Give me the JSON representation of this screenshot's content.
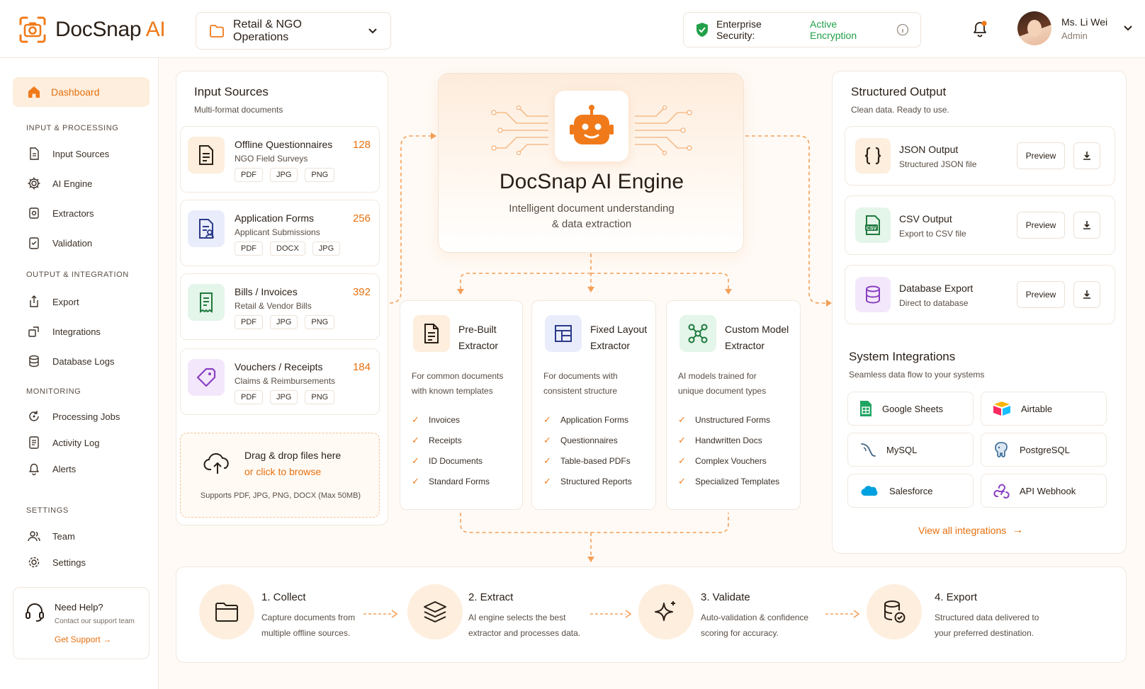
{
  "header": {
    "logo_main": "DocSnap",
    "logo_accent": "AI",
    "workspace": "Retail & NGO Operations",
    "security_label": "Enterprise Security:",
    "security_value": "Active Encryption",
    "user_name": "Ms. Li Wei",
    "user_role": "Admin"
  },
  "sidebar": {
    "active": "Dashboard",
    "sections": [
      {
        "title": "INPUT & PROCESSING",
        "items": [
          "Input Sources",
          "AI Engine",
          "Extractors",
          "Validation"
        ]
      },
      {
        "title": "OUTPUT & INTEGRATION",
        "items": [
          "Export",
          "Integrations",
          "Database Logs"
        ]
      },
      {
        "title": "MONITORING",
        "items": [
          "Processing Jobs",
          "Activity Log",
          "Alerts"
        ]
      },
      {
        "title": "SETTINGS",
        "items": [
          "Team",
          "Settings"
        ]
      }
    ],
    "help": {
      "title": "Need Help?",
      "subtitle": "Contact our support team",
      "link": "Get Support"
    }
  },
  "input_sources": {
    "title": "Input Sources",
    "subtitle": "Multi-format documents",
    "items": [
      {
        "title": "Offline Questionnaires",
        "subtitle": "NGO Field Surveys",
        "count": "128",
        "tags": [
          "PDF",
          "JPG",
          "PNG"
        ]
      },
      {
        "title": "Application Forms",
        "subtitle": "Applicant Submissions",
        "count": "256",
        "tags": [
          "PDF",
          "DOCX",
          "JPG"
        ]
      },
      {
        "title": "Bills / Invoices",
        "subtitle": "Retail & Vendor Bills",
        "count": "392",
        "tags": [
          "PDF",
          "JPG",
          "PNG"
        ]
      },
      {
        "title": "Vouchers / Receipts",
        "subtitle": "Claims & Reimbursements",
        "count": "184",
        "tags": [
          "PDF",
          "JPG",
          "PNG"
        ]
      }
    ],
    "drop": {
      "title": "Drag & drop files here",
      "link": "or click to browse",
      "note": "Supports PDF, JPG, PNG, DOCX (Max 50MB)"
    }
  },
  "engine": {
    "title": "DocSnap AI Engine",
    "subtitle_1": "Intelligent document understanding",
    "subtitle_2": "& data extraction"
  },
  "extractors": [
    {
      "title_1": "Pre-Built",
      "title_2": "Extractor",
      "desc_1": "For common documents",
      "desc_2": "with known templates",
      "items": [
        "Invoices",
        "Receipts",
        "ID Documents",
        "Standard Forms"
      ]
    },
    {
      "title_1": "Fixed Layout",
      "title_2": "Extractor",
      "desc_1": "For documents with",
      "desc_2": "consistent structure",
      "items": [
        "Application Forms",
        "Questionnaires",
        "Table-based PDFs",
        "Structured Reports"
      ]
    },
    {
      "title_1": "Custom Model",
      "title_2": "Extractor",
      "desc_1": "AI models trained for",
      "desc_2": "unique document types",
      "items": [
        "Unstructured Forms",
        "Handwritten Docs",
        "Complex Vouchers",
        "Specialized Templates"
      ]
    }
  ],
  "output": {
    "title": "Structured Output",
    "subtitle": "Clean data. Ready to use.",
    "preview_label": "Preview",
    "items": [
      {
        "title": "JSON Output",
        "subtitle": "Structured JSON file"
      },
      {
        "title": "CSV Output",
        "subtitle": "Export to CSV file"
      },
      {
        "title": "Database Export",
        "subtitle": "Direct to database"
      }
    ]
  },
  "integrations": {
    "title": "System Integrations",
    "subtitle": "Seamless data flow to your systems",
    "items": [
      "Google Sheets",
      "Airtable",
      "MySQL",
      "PostgreSQL",
      "Salesforce",
      "API Webhook"
    ],
    "link": "View all integrations"
  },
  "steps": [
    {
      "title": "1. Collect",
      "d1": "Capture documents from",
      "d2": "multiple offline sources."
    },
    {
      "title": "2. Extract",
      "d1": "AI engine selects the best",
      "d2": "extractor and processes data."
    },
    {
      "title": "3. Validate",
      "d1": "Auto-validation & confidence",
      "d2": "scoring for accuracy."
    },
    {
      "title": "4. Export",
      "d1": "Structured data delivered to",
      "d2": "your preferred destination."
    }
  ],
  "colors": {
    "accent": "#f07a1a",
    "success": "#22a049"
  }
}
